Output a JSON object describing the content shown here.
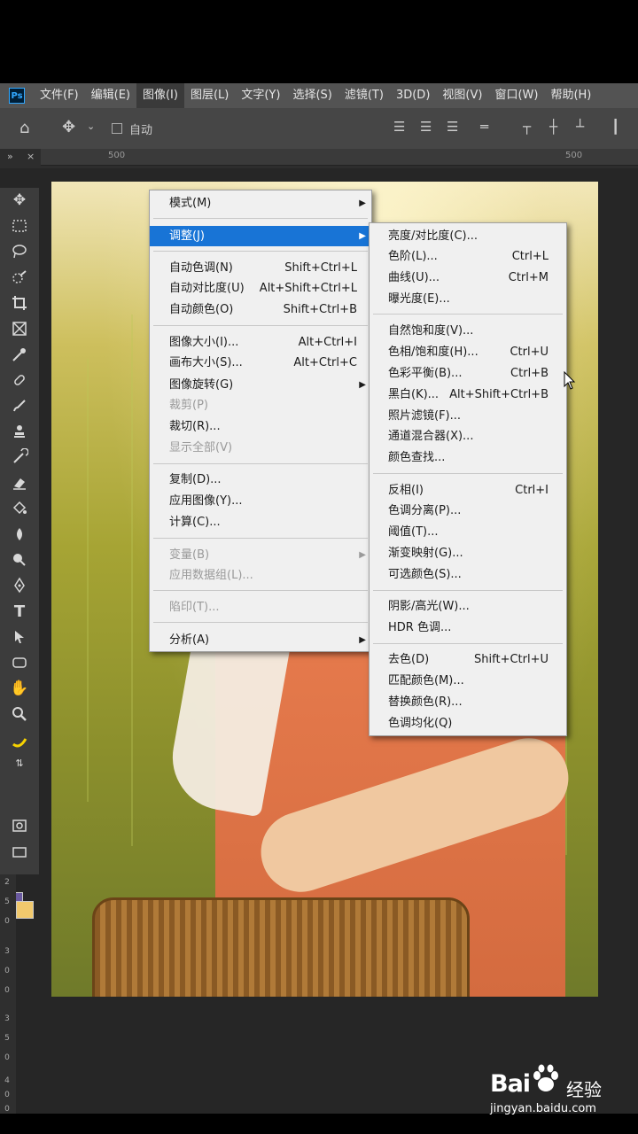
{
  "menubar": {
    "logo": "Ps",
    "items": [
      "文件(F)",
      "编辑(E)",
      "图像(I)",
      "图层(L)",
      "文字(Y)",
      "选择(S)",
      "滤镜(T)",
      "3D(D)",
      "视图(V)",
      "窗口(W)",
      "帮助(H)"
    ],
    "active_index": 2
  },
  "optbar": {
    "auto_select_label": "自动"
  },
  "ruler": {
    "top_ticks": [
      "500",
      "500"
    ],
    "left_digits": [
      "2",
      "5",
      "0",
      "3",
      "0",
      "0",
      "3",
      "5",
      "0",
      "4",
      "0",
      "0"
    ]
  },
  "image_menu": {
    "items": [
      {
        "label": "模式(M)",
        "shortcut": "",
        "arrow": true,
        "disabled": false
      },
      {
        "label": "调整(J)",
        "shortcut": "",
        "arrow": true,
        "disabled": false,
        "highlight": true
      },
      {
        "label": "自动色调(N)",
        "shortcut": "Shift+Ctrl+L",
        "disabled": false
      },
      {
        "label": "自动对比度(U)",
        "shortcut": "Alt+Shift+Ctrl+L",
        "disabled": false
      },
      {
        "label": "自动颜色(O)",
        "shortcut": "Shift+Ctrl+B",
        "disabled": false
      },
      {
        "label": "图像大小(I)...",
        "shortcut": "Alt+Ctrl+I",
        "disabled": false
      },
      {
        "label": "画布大小(S)...",
        "shortcut": "Alt+Ctrl+C",
        "disabled": false
      },
      {
        "label": "图像旋转(G)",
        "shortcut": "",
        "arrow": true,
        "disabled": false
      },
      {
        "label": "裁剪(P)",
        "shortcut": "",
        "disabled": true
      },
      {
        "label": "裁切(R)...",
        "shortcut": "",
        "disabled": false
      },
      {
        "label": "显示全部(V)",
        "shortcut": "",
        "disabled": true
      },
      {
        "label": "复制(D)...",
        "shortcut": "",
        "disabled": false
      },
      {
        "label": "应用图像(Y)...",
        "shortcut": "",
        "disabled": false
      },
      {
        "label": "计算(C)...",
        "shortcut": "",
        "disabled": false
      },
      {
        "label": "变量(B)",
        "shortcut": "",
        "arrow": true,
        "disabled": true
      },
      {
        "label": "应用数据组(L)...",
        "shortcut": "",
        "disabled": true
      },
      {
        "label": "陷印(T)...",
        "shortcut": "",
        "disabled": true
      },
      {
        "label": "分析(A)",
        "shortcut": "",
        "arrow": true,
        "disabled": false
      }
    ]
  },
  "adjust_menu": {
    "items": [
      {
        "label": "亮度/对比度(C)...",
        "shortcut": ""
      },
      {
        "label": "色阶(L)...",
        "shortcut": "Ctrl+L"
      },
      {
        "label": "曲线(U)...",
        "shortcut": "Ctrl+M"
      },
      {
        "label": "曝光度(E)...",
        "shortcut": ""
      },
      {
        "label": "自然饱和度(V)...",
        "shortcut": ""
      },
      {
        "label": "色相/饱和度(H)...",
        "shortcut": "Ctrl+U"
      },
      {
        "label": "色彩平衡(B)...",
        "shortcut": "Ctrl+B"
      },
      {
        "label": "黑白(K)...",
        "shortcut": "Alt+Shift+Ctrl+B"
      },
      {
        "label": "照片滤镜(F)...",
        "shortcut": ""
      },
      {
        "label": "通道混合器(X)...",
        "shortcut": ""
      },
      {
        "label": "颜色查找...",
        "shortcut": ""
      },
      {
        "label": "反相(I)",
        "shortcut": "Ctrl+I"
      },
      {
        "label": "色调分离(P)...",
        "shortcut": ""
      },
      {
        "label": "阈值(T)...",
        "shortcut": ""
      },
      {
        "label": "渐变映射(G)...",
        "shortcut": ""
      },
      {
        "label": "可选颜色(S)...",
        "shortcut": ""
      },
      {
        "label": "阴影/高光(W)...",
        "shortcut": ""
      },
      {
        "label": "HDR 色调...",
        "shortcut": ""
      },
      {
        "label": "去色(D)",
        "shortcut": "Shift+Ctrl+U"
      },
      {
        "label": "匹配颜色(M)...",
        "shortcut": ""
      },
      {
        "label": "替换颜色(R)...",
        "shortcut": ""
      },
      {
        "label": "色调均化(Q)",
        "shortcut": ""
      }
    ]
  },
  "watermark": {
    "logo": "Bai",
    "brand_cn": "经验",
    "url": "jingyan.baidu.com"
  },
  "colors": {
    "highlight": "#1874d6",
    "foreground": "#6a5aa0",
    "background": "#f1c96d"
  }
}
